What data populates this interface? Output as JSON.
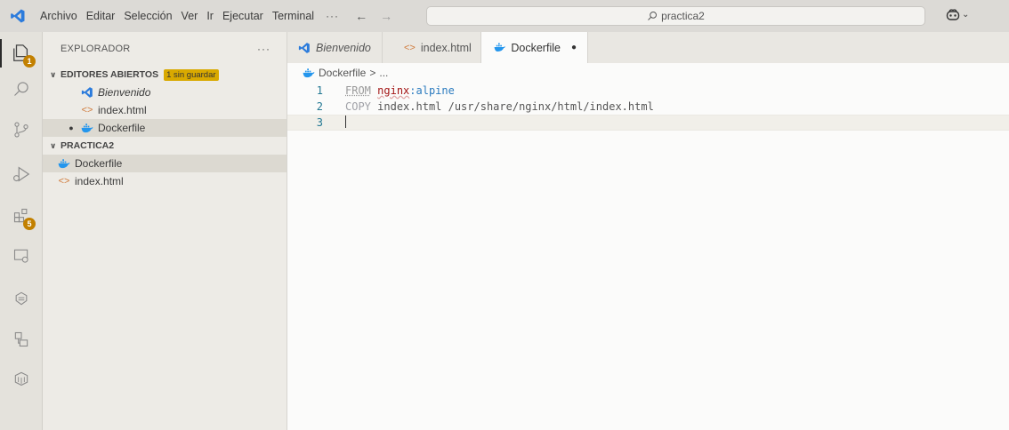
{
  "titlebar": {
    "menu": [
      "Archivo",
      "Editar",
      "Selección",
      "Ver",
      "Ir",
      "Ejecutar",
      "Terminal"
    ],
    "more": "···",
    "back_icon": "arrow-left-icon",
    "forward_icon": "arrow-right-icon",
    "search_text": "practica2"
  },
  "activity_bar": {
    "items": [
      "explorer-icon",
      "search-icon",
      "source-control-icon",
      "run-debug-icon",
      "extensions-icon",
      "remote-explorer-icon",
      "docker-icon",
      "containers-icon",
      "database-icon"
    ],
    "explorer_badge": "1",
    "extensions_badge": "5"
  },
  "sidebar": {
    "title": "EXPLORADOR",
    "more": "···",
    "open_editors": {
      "label": "EDITORES ABIERTOS",
      "unsaved": "1 sin guardar",
      "items": [
        "Bienvenido",
        "index.html",
        "Dockerfile"
      ]
    },
    "folder": {
      "label": "PRACTICA2",
      "items": [
        "Dockerfile",
        "index.html"
      ]
    }
  },
  "tabs": [
    {
      "label": "Bienvenido"
    },
    {
      "label": "index.html"
    },
    {
      "label": "Dockerfile",
      "dirty": "●"
    }
  ],
  "editor": {
    "breadcrumb_file": "Dockerfile",
    "breadcrumb_sep": ">",
    "breadcrumb_more": "...",
    "lines": [
      {
        "num": "1",
        "kw": "FROM",
        "image": "nginx",
        "colon": ":",
        "tag": "alpine"
      },
      {
        "num": "2",
        "kw": "COPY",
        "rest": "index.html /usr/share/nginx/html/index.html"
      },
      {
        "num": "3"
      }
    ]
  },
  "colors": {
    "accent_badge": "#c28000",
    "unsaved_badge": "#d9a900",
    "vscode_blue": "#2b7bdc",
    "line_number": "#237893"
  }
}
